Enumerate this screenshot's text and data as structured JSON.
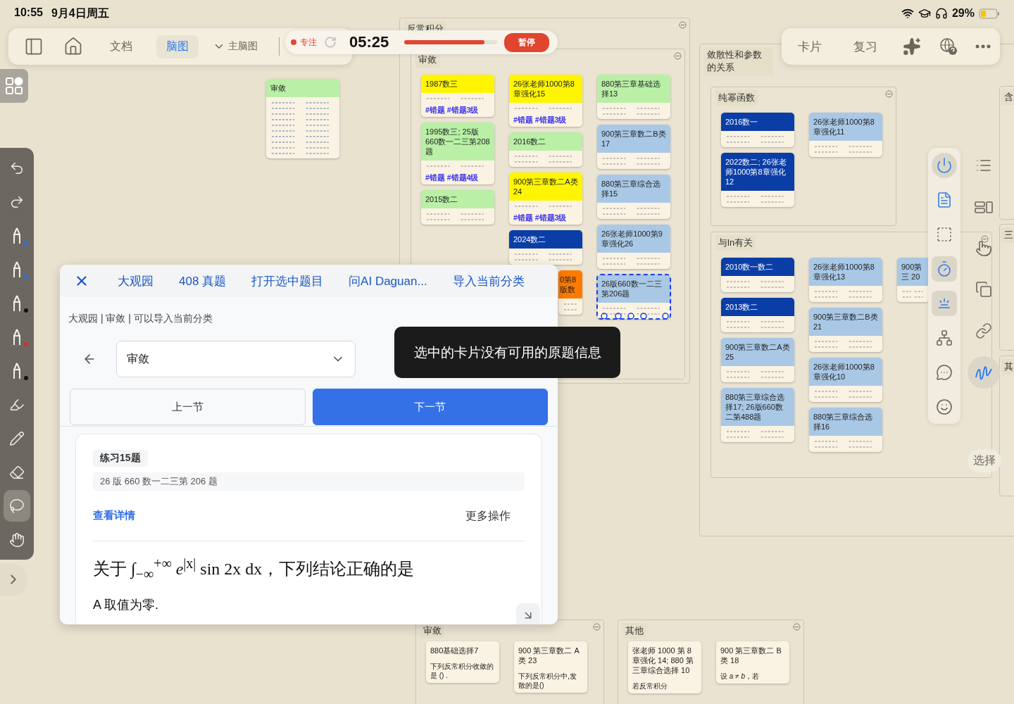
{
  "status_bar": {
    "time": "10:55",
    "date": "9月4日周五",
    "battery": "29%"
  },
  "toolbar": {
    "items": [
      {
        "kind": "sidebar"
      },
      {
        "kind": "home"
      },
      {
        "kind": "text",
        "label": "文档",
        "selected": false
      },
      {
        "kind": "text",
        "label": "脑图",
        "selected": true
      },
      {
        "kind": "dropdown",
        "label": "主脑图"
      }
    ]
  },
  "focus_timer": {
    "mode": "专注",
    "time": "05:25",
    "level": 0.86,
    "button": "暂停"
  },
  "right_toolbar": {
    "items": [
      {
        "kind": "text",
        "label": "卡片"
      },
      {
        "kind": "text",
        "label": "复习"
      },
      {
        "kind": "sparkle"
      },
      {
        "kind": "web-help"
      },
      {
        "kind": "more"
      }
    ]
  },
  "left_tools": [
    {
      "kind": "undo",
      "selected": false
    },
    {
      "kind": "redo",
      "selected": false
    },
    {
      "kind": "pen",
      "color": "#2f6fd6",
      "selected": false
    },
    {
      "kind": "pen",
      "color": "#2f6fd6",
      "selected": false
    },
    {
      "kind": "pen",
      "color": "#111111",
      "selected": false
    },
    {
      "kind": "pen",
      "color": "#e0262b",
      "selected": false
    },
    {
      "kind": "pen",
      "color": "#111111",
      "selected": false
    },
    {
      "kind": "highlighter",
      "selected": false
    },
    {
      "kind": "pencil",
      "selected": false
    },
    {
      "kind": "eraser",
      "selected": false
    },
    {
      "kind": "lasso",
      "selected": true
    },
    {
      "kind": "hand",
      "selected": false
    }
  ],
  "canvas": {
    "card": {
      "title": "审敛",
      "color": "#b9f0a6"
    },
    "groups": [
      {
        "title": "反常积分",
        "groups": [
          {
            "title": "审敛",
            "columns": [
              [
                {
                  "title": "1987数三",
                  "color": "#fff500",
                  "tags": "#错题 #错题3级"
                },
                {
                  "title": "1995数三; 25版660数一二三第208题",
                  "color": "#b9f0a6",
                  "tags": "#错题 #错题4级"
                },
                {
                  "title": "2015数二",
                  "color": "#b9f0a6"
                }
              ],
              [
                {
                  "title": "26张老师1000第8章强化15",
                  "color": "#fff500",
                  "tags": "#错题 #错题3级"
                },
                {
                  "title": "2016数二",
                  "color": "#b9f0a6"
                },
                {
                  "title": "900第三章数二A类24",
                  "color": "#fff500",
                  "tags": "#错题 #错题3级"
                },
                {
                  "title": "2024数二",
                  "color": "#0a3ea6"
                },
                {
                  "title": "0第8 版数",
                  "color": "#ff7a00",
                  "cut_left": true
                }
              ],
              [
                {
                  "title": "880第三章基础选择13",
                  "color": "#b9f0a6"
                },
                {
                  "title": "900第三章数二B类17",
                  "color": "#a9c8e6"
                },
                {
                  "title": "880第三章综合选择15",
                  "color": "#a9c8e6"
                },
                {
                  "title": "26张老师1000第9章强化26",
                  "color": "#a9c8e6"
                },
                {
                  "title": "26版660数一二三第206题",
                  "color": "#a9c8e6",
                  "selected": true
                }
              ]
            ]
          }
        ]
      },
      {
        "title": "敛散性和参数的关系",
        "groups": [
          {
            "title": "纯幂函数",
            "columns": [
              [
                {
                  "title": "2016数一",
                  "color": "#0a3ea6"
                },
                {
                  "title": "2022数二; 26张老师1000第8章强化12",
                  "color": "#0a3ea6"
                }
              ],
              [
                {
                  "title": "26张老师1000第8章强化11",
                  "color": "#a9c8e6"
                }
              ]
            ]
          },
          {
            "title": "与ln有关",
            "columns": [
              [
                {
                  "title": "2010数一数二",
                  "color": "#0a3ea6"
                },
                {
                  "title": "2013数二",
                  "color": "#0a3ea6"
                },
                {
                  "title": "900第三章数二A类25",
                  "color": "#a9c8e6"
                },
                {
                  "title": "880第三章综合选择17; 26版660数二第488题",
                  "color": "#a9c8e6"
                }
              ],
              [
                {
                  "title": "26张老师1000第8章强化13",
                  "color": "#a9c8e6"
                },
                {
                  "title": "900第三章数二B类21",
                  "color": "#a9c8e6"
                },
                {
                  "title": "26张老师1000第8章强化10",
                  "color": "#a9c8e6"
                },
                {
                  "title": "880第三章综合选择16",
                  "color": "#a9c8e6"
                }
              ],
              [
                {
                  "title": "900第三 20",
                  "color": "#a9c8e6",
                  "cut_right": true
                }
              ]
            ]
          }
        ]
      },
      {
        "title": "含"
      },
      {
        "title": "三"
      },
      {
        "title": "其"
      },
      {
        "title": "审敛",
        "columns": [
          [
            {
              "title": "880基础选择7",
              "lines": [
                "下列反常积分收敛的是 () ."
              ]
            }
          ],
          [
            {
              "title": "900 第三章数二 A 类 23",
              "lines": [
                "下列反常积分中,发散的是()"
              ]
            }
          ]
        ]
      },
      {
        "title": "其他",
        "columns": [
          [
            {
              "title": "张老师 1000 第 8 章强化 14; 880 第三章综合选择 10",
              "lines": [
                "若反常积分"
              ]
            }
          ],
          [
            {
              "title": "900 第三章数二 B 类 18",
              "lines": [
                "设 *a* ≠ *b*，若"
              ]
            }
          ]
        ]
      }
    ]
  },
  "side_tools": [
    {
      "kind": "power",
      "selected": true
    },
    {
      "kind": "note-branch",
      "selected": false
    },
    {
      "kind": "text-box",
      "selected": false
    },
    {
      "kind": "timer",
      "selected": true
    },
    {
      "kind": "light",
      "selected": true
    },
    {
      "kind": "nodes",
      "selected": false
    },
    {
      "kind": "chat",
      "selected": false
    },
    {
      "kind": "smiley",
      "selected": false
    }
  ],
  "side_tools_2": [
    {
      "kind": "list",
      "selected": false
    },
    {
      "kind": "layout",
      "selected": false
    },
    {
      "kind": "hand",
      "selected": false
    },
    {
      "kind": "copy",
      "selected": false
    },
    {
      "kind": "link",
      "selected": false
    },
    {
      "kind": "squiggle",
      "selected": true
    }
  ],
  "select_button": "选择",
  "panel": {
    "tabs": [
      "大观园",
      "408 真题",
      "打开选中题目",
      "问AI Daguan...",
      "导入当前分类"
    ],
    "breadcrumb": "大观园 | 审敛 | 可以导入当前分类",
    "category": {
      "value": "审敛"
    },
    "buttons": [
      {
        "label": "上一节",
        "kind": "secondary"
      },
      {
        "label": "下一节",
        "kind": "primary"
      }
    ],
    "question": {
      "badge": "练习15题",
      "source": "26 版 660 数一二三第 206 题",
      "detail_link": "查看详情",
      "more": "更多操作",
      "text": "关于 ∫$_{−∞}$$^{+∞}$ *e*$^{|x|}$ sin 2x dx，下列结论正确的是",
      "option": "A 取值为零."
    }
  },
  "toast": "选中的卡片没有可用的原题信息"
}
